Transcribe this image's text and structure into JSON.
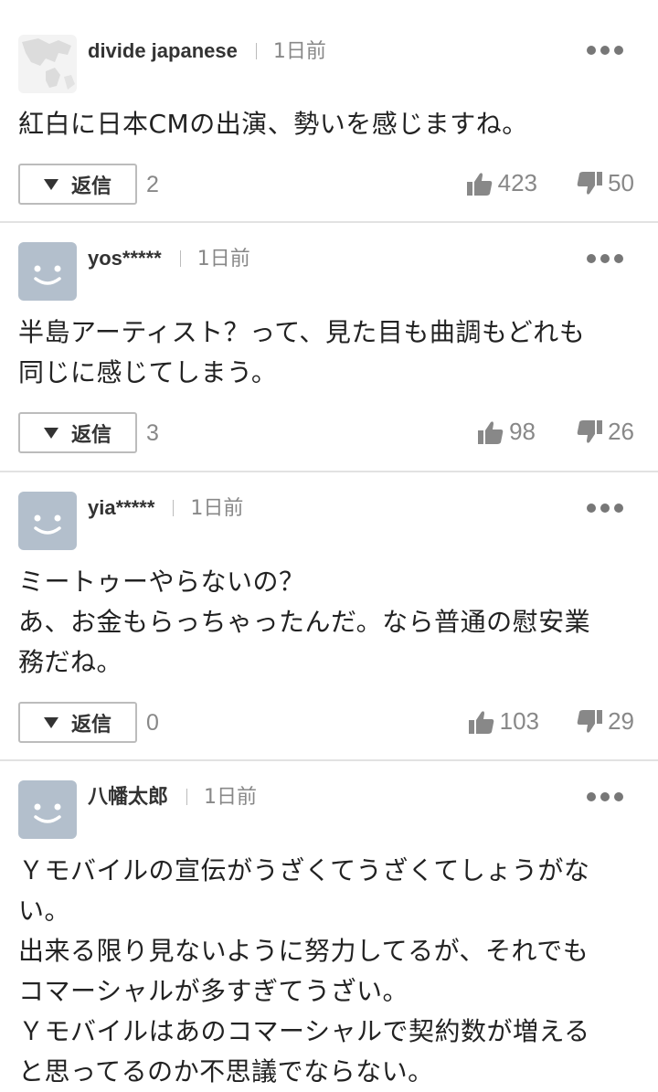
{
  "comments": [
    {
      "user": "divide japanese",
      "time": "1日前",
      "lines": [
        "紅白に日本CMの出演、勢いを感じますね。"
      ],
      "reply_label": "返信",
      "reply_count": "2",
      "likes": "423",
      "dislikes": "50",
      "avatar": "world-map-avatar"
    },
    {
      "user": "yos*****",
      "time": "1日前",
      "lines": [
        "半島アーティスト？って、見た目も曲調もどれも",
        "同じに感じてしまう。"
      ],
      "reply_label": "返信",
      "reply_count": "3",
      "likes": "98",
      "dislikes": "26",
      "avatar": "smiley-avatar"
    },
    {
      "user": "yia*****",
      "time": "1日前",
      "lines": [
        "ミートゥーやらないの？",
        "あ、お金もらっちゃったんだ。なら普通の慰安業",
        "務だね。"
      ],
      "reply_label": "返信",
      "reply_count": "0",
      "likes": "103",
      "dislikes": "29",
      "avatar": "smiley-avatar"
    },
    {
      "user": "八幡太郎",
      "time": "1日前",
      "lines": [
        "Ｙモバイルの宣伝がうざくてうざくてしょうがな",
        "い。",
        "出来る限り見ないように努力してるが、それでも",
        "コマーシャルが多すぎてうざい。",
        "Ｙモバイルはあのコマーシャルで契約数が増える",
        "と思ってるのか不思議でならない。"
      ],
      "avatar": "smiley-avatar"
    }
  ],
  "colors": {
    "avatar_bg": "#b3bfcc",
    "divider": "#e2e2e2",
    "muted": "#888888"
  }
}
